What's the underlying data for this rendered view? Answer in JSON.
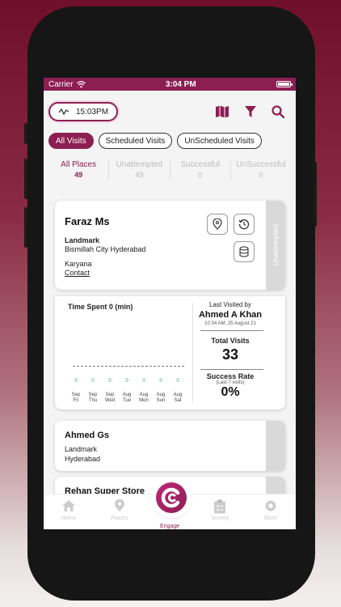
{
  "status_bar": {
    "carrier": "Carrier",
    "time": "3:04 PM"
  },
  "header": {
    "clock_time": "15:03PM"
  },
  "filters": [
    {
      "label": "All Visits",
      "active": true
    },
    {
      "label": "Scheduled Visits",
      "active": false
    },
    {
      "label": "UnScheduled Visits",
      "active": false
    }
  ],
  "stats": [
    {
      "label": "All Places",
      "count": "49",
      "active": true
    },
    {
      "label": "Unattempted",
      "count": "49",
      "active": false
    },
    {
      "label": "Successful",
      "count": "0",
      "active": false
    },
    {
      "label": "UnSuccessful",
      "count": "0",
      "active": false
    }
  ],
  "visit_card": {
    "name": "Faraz Ms",
    "landmark_label": "Landmark",
    "address": "Bismillah City Hyderabad",
    "category": "Karyana",
    "contact_link": "Contact",
    "status": "Unattempted"
  },
  "visit_details": {
    "time_spent_label": "Time Spent",
    "time_spent_value": "0 (min)",
    "days": [
      {
        "value": "0",
        "date": "Sep",
        "weekday": "Fri"
      },
      {
        "value": "0",
        "date": "Sep",
        "weekday": "Thu"
      },
      {
        "value": "0",
        "date": "Sep",
        "weekday": "Wed"
      },
      {
        "value": "0",
        "date": "Aug",
        "weekday": "Tue"
      },
      {
        "value": "0",
        "date": "Aug",
        "weekday": "Mon"
      },
      {
        "value": "0",
        "date": "Aug",
        "weekday": "Sun"
      },
      {
        "value": "0",
        "date": "Aug",
        "weekday": "Sat"
      }
    ],
    "last_visited_label": "Last Visited by",
    "last_visited_by": "Ahmed A Khan",
    "last_visited_time": "10:34 AM, 25 August 21",
    "total_visits_label": "Total Visits",
    "total_visits": "33",
    "success_rate_label": "Success Rate",
    "success_rate_sub": "(Last 7 visits)",
    "success_rate": "0%"
  },
  "cards": [
    {
      "name": "Ahmed Gs",
      "landmark_label": "Landmark",
      "address": "Hyderabad"
    },
    {
      "name": "Rehan Super Store"
    }
  ],
  "tabbar": [
    {
      "label": "Home",
      "icon": "home-icon"
    },
    {
      "label": "Places",
      "icon": "map-pin-icon"
    },
    {
      "label": "Engage",
      "icon": "engage-logo-icon"
    },
    {
      "label": "Survey",
      "icon": "clipboard-icon"
    },
    {
      "label": "More",
      "icon": "gear-icon"
    }
  ],
  "colors": {
    "brand": "#8c1f52",
    "strip": "#d9d9d9"
  }
}
